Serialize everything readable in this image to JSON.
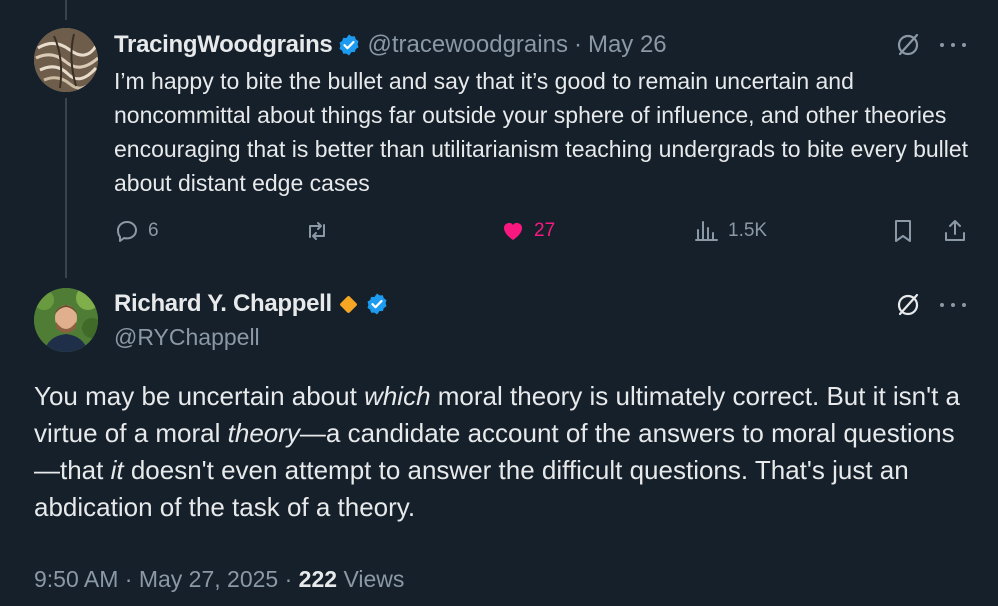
{
  "reply": {
    "display_name": "TracingWoodgrains",
    "handle": "@tracewoodgrains",
    "separator": "·",
    "date": "May 26",
    "text": "I’m happy to bite the bullet and say that it’s good to remain uncertain and noncommittal about things far outside your sphere of influence, and other theories encouraging that is better than utilitarianism teaching undergrads to bite every bullet about distant edge cases",
    "replies": "6",
    "reposts": "",
    "likes": "27",
    "views": "1.5K"
  },
  "main": {
    "display_name": "Richard Y. Chappell",
    "handle": "@RYChappell",
    "text_parts": {
      "p1": "You may be uncertain about ",
      "i1": "which",
      "p2": " moral theory is ultimately correct. But it isn't a virtue of a moral ",
      "i2": "theory",
      "p3": "—a candidate account of the answers to moral questions—that ",
      "i3": "it",
      "p4": " doesn't even attempt to answer the difficult questions. That's just an abdication of the task of a theory."
    },
    "time": "9:50 AM",
    "separator": "·",
    "date": "May 27, 2025",
    "views_count": "222",
    "views_label": "Views"
  },
  "colors": {
    "background": "#15202b",
    "text": "#e7e9ea",
    "muted": "#8b98a5",
    "verified": "#1d9bf0",
    "like": "#f91880",
    "affiliate_diamond": "#f5a623"
  },
  "icons": [
    "verified-badge-icon",
    "grok-icon",
    "more-icon",
    "reply-icon",
    "repost-icon",
    "like-icon",
    "views-icon",
    "bookmark-icon",
    "share-icon",
    "affiliate-diamond-icon"
  ]
}
